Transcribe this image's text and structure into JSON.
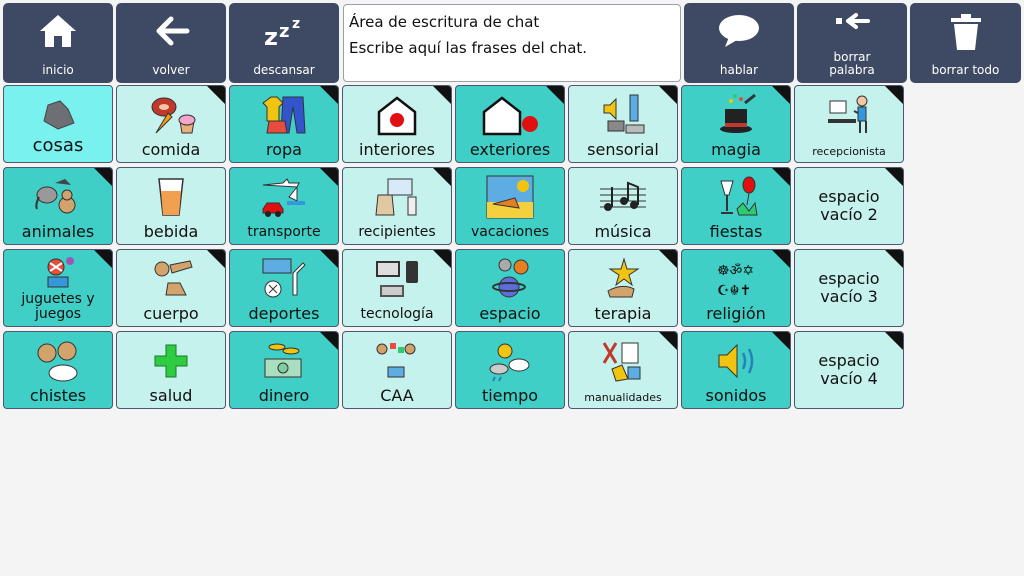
{
  "toolbar": {
    "inicio": "inicio",
    "volver": "volver",
    "descansar": "descansar",
    "hablar": "hablar",
    "borrar_palabra": "borrar palabra",
    "borrar_todo": "borrar todo"
  },
  "chat": {
    "line1": "Área de escritura de chat",
    "line2": "Escribe aquí las frases del chat."
  },
  "colors": {
    "toolbar": "#3e4a63",
    "teal": "#3fcfc6",
    "light": "#c6f2ee",
    "cyan": "#79f1ee"
  },
  "cells": {
    "cosas": "cosas",
    "comida": "comida",
    "ropa": "ropa",
    "interiores": "interiores",
    "exteriores": "exteriores",
    "sensorial": "sensorial",
    "magia": "magia",
    "recepcionista": "recepcionista",
    "animales": "animales",
    "bebida": "bebida",
    "transporte": "transporte",
    "recipientes": "recipientes",
    "vacaciones": "vacaciones",
    "musica": "música",
    "fiestas": "fiestas",
    "espacio_vacio_2": "espacio vacío 2",
    "juguetes": "juguetes y juegos",
    "cuerpo": "cuerpo",
    "deportes": "deportes",
    "tecnologia": "tecnología",
    "espacio": "espacio",
    "terapia": "terapia",
    "religion": "religión",
    "espacio_vacio_3": "espacio vacío 3",
    "chistes": "chistes",
    "salud": "salud",
    "dinero": "dinero",
    "caa": "CAA",
    "tiempo": "tiempo",
    "manualidades": "manualidades",
    "sonidos": "sonidos",
    "espacio_vacio_4": "espacio vacío 4"
  }
}
